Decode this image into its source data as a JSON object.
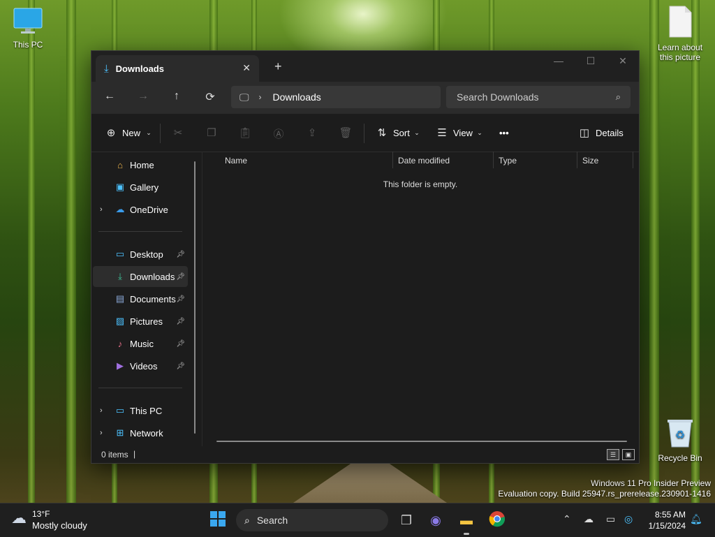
{
  "desktop": {
    "icons": [
      {
        "label": "This PC",
        "icon": "monitor-icon"
      },
      {
        "label": "Learn about this picture",
        "icon": "document-icon"
      },
      {
        "label": "Recycle Bin",
        "icon": "recycle-bin-icon"
      }
    ],
    "watermark": {
      "line1": "Windows 11 Pro Insider Preview",
      "line2": "Evaluation copy. Build 25947.rs_prerelease.230901-1416"
    }
  },
  "window": {
    "tab": {
      "title": "Downloads",
      "close": "✕"
    },
    "new_tab": "+",
    "caption": {
      "minimize": "—",
      "maximize": "☐",
      "close": "✕"
    },
    "nav": {
      "back": "←",
      "forward": "→",
      "up": "↑",
      "refresh": "⟳"
    },
    "address": {
      "crumb": "Downloads"
    },
    "search": {
      "placeholder": "Search Downloads"
    },
    "command_bar": {
      "new_label": "New",
      "sort_label": "Sort",
      "view_label": "View",
      "more": "•••",
      "details_label": "Details"
    },
    "sidebar": {
      "items": [
        {
          "label": "Home",
          "icon": "home-icon"
        },
        {
          "label": "Gallery",
          "icon": "gallery-icon"
        },
        {
          "label": "OneDrive",
          "icon": "onedrive-icon"
        },
        {
          "label": "Desktop",
          "icon": "desktop-icon"
        },
        {
          "label": "Downloads",
          "icon": "download-icon"
        },
        {
          "label": "Documents",
          "icon": "documents-icon"
        },
        {
          "label": "Pictures",
          "icon": "pictures-icon"
        },
        {
          "label": "Music",
          "icon": "music-icon"
        },
        {
          "label": "Videos",
          "icon": "videos-icon"
        },
        {
          "label": "This PC",
          "icon": "this-pc-icon"
        },
        {
          "label": "Network",
          "icon": "network-icon"
        }
      ],
      "selected": "Downloads"
    },
    "columns": [
      "Name",
      "Date modified",
      "Type",
      "Size"
    ],
    "empty_message": "This folder is empty.",
    "status": {
      "count": "0 items",
      "cursor": "|"
    }
  },
  "taskbar": {
    "weather": {
      "temp": "13°F",
      "condition": "Mostly cloudy"
    },
    "search_placeholder": "Search",
    "clock": {
      "time": "8:55 AM",
      "date": "1/15/2024"
    }
  },
  "colors": {
    "accent": "#4cc2ff",
    "window_bg": "#1c1c1c",
    "taskbar_bg": "#1f1f1f"
  }
}
